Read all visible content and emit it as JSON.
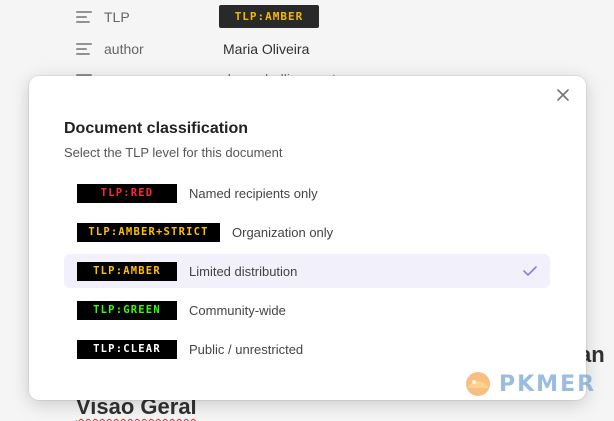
{
  "properties": [
    {
      "key": "TLP",
      "value": "TLP:AMBER",
      "icon": "list-icon"
    },
    {
      "key": "author",
      "value": "Maria Oliveira",
      "icon": "list-icon"
    },
    {
      "key": "",
      "value": "dev ... hellip ... seto",
      "icon": "list-icon"
    }
  ],
  "background": {
    "heading": "Visao Geral",
    "heading_right": "an"
  },
  "modal": {
    "title": "Document classification",
    "subtitle": "Select the TLP level for this document",
    "close_icon": "close-icon",
    "options": [
      {
        "badge": "TLP:RED",
        "label": "Named recipients only",
        "color": "#ff2b2b",
        "selected": false
      },
      {
        "badge": "TLP:AMBER+STRICT",
        "label": "Organization only",
        "color": "#ffc000",
        "selected": false
      },
      {
        "badge": "TLP:AMBER",
        "label": "Limited distribution",
        "color": "#ffc000",
        "selected": true
      },
      {
        "badge": "TLP:GREEN",
        "label": "Community-wide",
        "color": "#33ff00",
        "selected": false
      },
      {
        "badge": "TLP:CLEAR",
        "label": "Public / unrestricted",
        "color": "#ffffff",
        "selected": false
      }
    ],
    "check_icon": "check-icon",
    "accent": "#8a7fd8"
  },
  "watermark": {
    "text": "PKMER"
  }
}
